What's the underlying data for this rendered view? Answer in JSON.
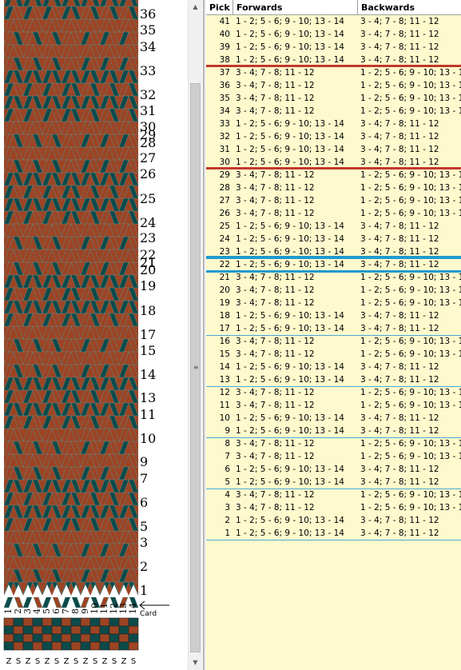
{
  "left_pane": {
    "pick_numbers": [
      "36",
      "35",
      "34",
      "33",
      "32",
      "31",
      "30",
      "29",
      "28",
      "27",
      "26",
      "25",
      "24",
      "23",
      "22",
      "21",
      "20",
      "19",
      "18",
      "17",
      "15",
      "14",
      "13",
      "11",
      "10",
      "9",
      "7",
      "6",
      "5",
      "3",
      "2",
      "1"
    ],
    "card_numbers": [
      "1",
      "2",
      "3",
      "4",
      "5",
      "6",
      "7",
      "8",
      "9",
      "10",
      "11",
      "12",
      "13",
      "14"
    ],
    "card_label": "Card",
    "thread_directions": [
      "Z",
      "S",
      "Z",
      "S",
      "Z",
      "S",
      "Z",
      "S",
      "Z",
      "S",
      "Z",
      "S",
      "Z",
      "S"
    ]
  },
  "colors": {
    "rust": "#9c4424",
    "teal": "#0d4a4a",
    "row_bg": "#fffacd",
    "red_divider": "#c0392b",
    "blue_divider": "#1f9bd0",
    "thin_divider": "#4aa8d8"
  },
  "table": {
    "headers": {
      "pick": "Pick",
      "forwards": "Forwards",
      "backwards": "Backwards"
    },
    "rows": [
      {
        "pick": "41",
        "fwd": "1 - 2; 5 - 6; 9 - 10; 13 - 14",
        "bwd": "3 - 4; 7 - 8; 11 - 12"
      },
      {
        "pick": "40",
        "fwd": "1 - 2; 5 - 6; 9 - 10; 13 - 14",
        "bwd": "3 - 4; 7 - 8; 11 - 12"
      },
      {
        "pick": "39",
        "fwd": "1 - 2; 5 - 6; 9 - 10; 13 - 14",
        "bwd": "3 - 4; 7 - 8; 11 - 12"
      },
      {
        "pick": "38",
        "fwd": "1 - 2; 5 - 6; 9 - 10; 13 - 14",
        "bwd": "3 - 4; 7 - 8; 11 - 12"
      },
      {
        "pick": "37",
        "fwd": "3 - 4; 7 - 8; 11 - 12",
        "bwd": "1 - 2; 5 - 6; 9 - 10; 13 - 14"
      },
      {
        "pick": "36",
        "fwd": "3 - 4; 7 - 8; 11 - 12",
        "bwd": "1 - 2; 5 - 6; 9 - 10; 13 - 14"
      },
      {
        "pick": "35",
        "fwd": "3 - 4; 7 - 8; 11 - 12",
        "bwd": "1 - 2; 5 - 6; 9 - 10; 13 - 14"
      },
      {
        "pick": "34",
        "fwd": "3 - 4; 7 - 8; 11 - 12",
        "bwd": "1 - 2; 5 - 6; 9 - 10; 13 - 14"
      },
      {
        "pick": "33",
        "fwd": "1 - 2; 5 - 6; 9 - 10; 13 - 14",
        "bwd": "3 - 4; 7 - 8; 11 - 12"
      },
      {
        "pick": "32",
        "fwd": "1 - 2; 5 - 6; 9 - 10; 13 - 14",
        "bwd": "3 - 4; 7 - 8; 11 - 12"
      },
      {
        "pick": "31",
        "fwd": "1 - 2; 5 - 6; 9 - 10; 13 - 14",
        "bwd": "3 - 4; 7 - 8; 11 - 12"
      },
      {
        "pick": "30",
        "fwd": "1 - 2; 5 - 6; 9 - 10; 13 - 14",
        "bwd": "3 - 4; 7 - 8; 11 - 12"
      },
      {
        "pick": "29",
        "fwd": "3 - 4; 7 - 8; 11 - 12",
        "bwd": "1 - 2; 5 - 6; 9 - 10; 13 - 14"
      },
      {
        "pick": "28",
        "fwd": "3 - 4; 7 - 8; 11 - 12",
        "bwd": "1 - 2; 5 - 6; 9 - 10; 13 - 14"
      },
      {
        "pick": "27",
        "fwd": "3 - 4; 7 - 8; 11 - 12",
        "bwd": "1 - 2; 5 - 6; 9 - 10; 13 - 14"
      },
      {
        "pick": "26",
        "fwd": "3 - 4; 7 - 8; 11 - 12",
        "bwd": "1 - 2; 5 - 6; 9 - 10; 13 - 14"
      },
      {
        "pick": "25",
        "fwd": "1 - 2; 5 - 6; 9 - 10; 13 - 14",
        "bwd": "3 - 4; 7 - 8; 11 - 12"
      },
      {
        "pick": "24",
        "fwd": "1 - 2; 5 - 6; 9 - 10; 13 - 14",
        "bwd": "3 - 4; 7 - 8; 11 - 12"
      },
      {
        "pick": "23",
        "fwd": "1 - 2; 5 - 6; 9 - 10; 13 - 14",
        "bwd": "3 - 4; 7 - 8; 11 - 12"
      },
      {
        "pick": "22",
        "fwd": "1 - 2; 5 - 6; 9 - 10; 13 - 14",
        "bwd": "3 - 4; 7 - 8; 11 - 12"
      },
      {
        "pick": "21",
        "fwd": "3 - 4; 7 - 8; 11 - 12",
        "bwd": "1 - 2; 5 - 6; 9 - 10; 13 - 14"
      },
      {
        "pick": "20",
        "fwd": "3 - 4; 7 - 8; 11 - 12",
        "bwd": "1 - 2; 5 - 6; 9 - 10; 13 - 14"
      },
      {
        "pick": "19",
        "fwd": "3 - 4; 7 - 8; 11 - 12",
        "bwd": "1 - 2; 5 - 6; 9 - 10; 13 - 14"
      },
      {
        "pick": "18",
        "fwd": "1 - 2; 5 - 6; 9 - 10; 13 - 14",
        "bwd": "3 - 4; 7 - 8; 11 - 12"
      },
      {
        "pick": "17",
        "fwd": "1 - 2; 5 - 6; 9 - 10; 13 - 14",
        "bwd": "3 - 4; 7 - 8; 11 - 12"
      },
      {
        "pick": "16",
        "fwd": "3 - 4; 7 - 8; 11 - 12",
        "bwd": "1 - 2; 5 - 6; 9 - 10; 13 - 14"
      },
      {
        "pick": "15",
        "fwd": "3 - 4; 7 - 8; 11 - 12",
        "bwd": "1 - 2; 5 - 6; 9 - 10; 13 - 14"
      },
      {
        "pick": "14",
        "fwd": "1 - 2; 5 - 6; 9 - 10; 13 - 14",
        "bwd": "3 - 4; 7 - 8; 11 - 12"
      },
      {
        "pick": "13",
        "fwd": "1 - 2; 5 - 6; 9 - 10; 13 - 14",
        "bwd": "3 - 4; 7 - 8; 11 - 12"
      },
      {
        "pick": "12",
        "fwd": "3 - 4; 7 - 8; 11 - 12",
        "bwd": "1 - 2; 5 - 6; 9 - 10; 13 - 14"
      },
      {
        "pick": "11",
        "fwd": "3 - 4; 7 - 8; 11 - 12",
        "bwd": "1 - 2; 5 - 6; 9 - 10; 13 - 14"
      },
      {
        "pick": "10",
        "fwd": "1 - 2; 5 - 6; 9 - 10; 13 - 14",
        "bwd": "3 - 4; 7 - 8; 11 - 12"
      },
      {
        "pick": "9",
        "fwd": "1 - 2; 5 - 6; 9 - 10; 13 - 14",
        "bwd": "3 - 4; 7 - 8; 11 - 12"
      },
      {
        "pick": "8",
        "fwd": "3 - 4; 7 - 8; 11 - 12",
        "bwd": "1 - 2; 5 - 6; 9 - 10; 13 - 14"
      },
      {
        "pick": "7",
        "fwd": "3 - 4; 7 - 8; 11 - 12",
        "bwd": "1 - 2; 5 - 6; 9 - 10; 13 - 14"
      },
      {
        "pick": "6",
        "fwd": "1 - 2; 5 - 6; 9 - 10; 13 - 14",
        "bwd": "3 - 4; 7 - 8; 11 - 12"
      },
      {
        "pick": "5",
        "fwd": "1 - 2; 5 - 6; 9 - 10; 13 - 14",
        "bwd": "3 - 4; 7 - 8; 11 - 12"
      },
      {
        "pick": "4",
        "fwd": "3 - 4; 7 - 8; 11 - 12",
        "bwd": "1 - 2; 5 - 6; 9 - 10; 13 - 14"
      },
      {
        "pick": "3",
        "fwd": "3 - 4; 7 - 8; 11 - 12",
        "bwd": "1 - 2; 5 - 6; 9 - 10; 13 - 14"
      },
      {
        "pick": "2",
        "fwd": "1 - 2; 5 - 6; 9 - 10; 13 - 14",
        "bwd": "3 - 4; 7 - 8; 11 - 12"
      },
      {
        "pick": "1",
        "fwd": "1 - 2; 5 - 6; 9 - 10; 13 - 14",
        "bwd": "3 - 4; 7 - 8; 11 - 12"
      }
    ]
  }
}
